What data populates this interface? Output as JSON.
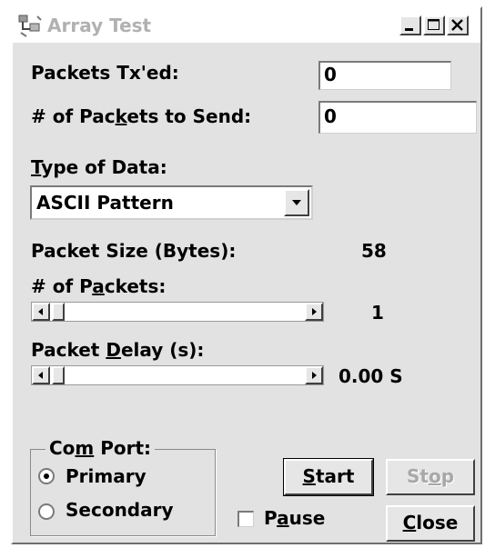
{
  "window": {
    "title": "Array Test",
    "icon": "app-icon",
    "controls": [
      "minimize-icon",
      "maximize-icon",
      "close-icon"
    ]
  },
  "fields": {
    "packets_txed": {
      "label": "Packets Tx'ed:",
      "value": "0"
    },
    "packets_to_send": {
      "label_pre": "# of Pac",
      "label_u": "k",
      "label_post": "ets to Send:",
      "value": "0"
    }
  },
  "type_of_data": {
    "label_u": "T",
    "label_rest": "ype of Data:",
    "selected": "ASCII Pattern"
  },
  "packet_size": {
    "label": "Packet Size (Bytes):",
    "value": "58"
  },
  "num_packets": {
    "label_pre": "# of P",
    "label_u": "a",
    "label_post": "ckets:",
    "value": "1",
    "slider_fraction": 0.0
  },
  "packet_delay": {
    "label_pre": "Packet ",
    "label_u": "D",
    "label_post": "elay (s):",
    "value": "0.00 S",
    "slider_fraction": 0.0
  },
  "com_port": {
    "legend_pre": "Co",
    "legend_u": "m",
    "legend_post": " Port:",
    "options": [
      {
        "label": "Primary",
        "selected": true
      },
      {
        "label": "Secondary",
        "selected": false
      }
    ]
  },
  "pause": {
    "label_pre": "P",
    "label_u": "a",
    "label_post": "use",
    "checked": false
  },
  "buttons": {
    "start": {
      "label_u": "S",
      "label_rest": "tart",
      "enabled": true
    },
    "stop": {
      "label_pre": "St",
      "label_u": "o",
      "label_post": "p",
      "enabled": false
    },
    "close": {
      "label_u": "C",
      "label_rest": "lose",
      "enabled": true
    }
  }
}
